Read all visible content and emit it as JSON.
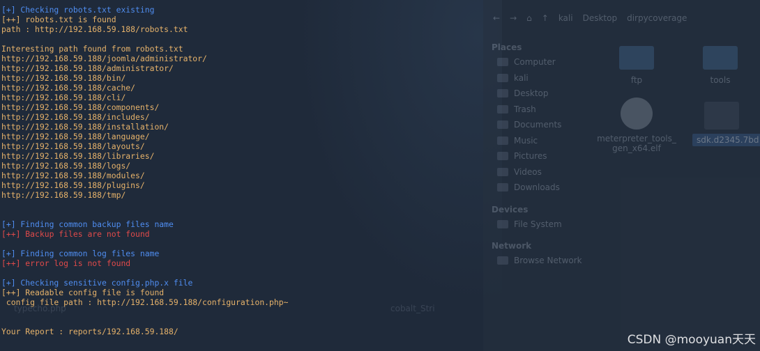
{
  "file_manager": {
    "toolbar": [
      "←",
      "→",
      "⌂",
      "↑",
      "kali",
      "Desktop",
      "dirpycoverage"
    ],
    "places_title": "Places",
    "places": [
      "Computer",
      "kali",
      "Desktop",
      "Trash",
      "Documents",
      "Music",
      "Pictures",
      "Videos",
      "Downloads"
    ],
    "devices_title": "Devices",
    "devices": [
      "File System"
    ],
    "network_title": "Network",
    "network": [
      "Browse Network"
    ],
    "files": [
      {
        "name": "ftp",
        "kind": "folder"
      },
      {
        "name": "tools",
        "kind": "folder"
      },
      {
        "name": "meterpreter_tools_gen_x64.elf",
        "kind": "gear"
      },
      {
        "name": "sdk.d2345.7bd",
        "kind": "selected"
      }
    ]
  },
  "desktop_icons": [
    "typecho.php",
    "cobalt_Stri"
  ],
  "terminal": {
    "lines": [
      {
        "text": "[+] Checking robots.txt existing",
        "color": "blue"
      },
      {
        "text": "[++] robots.txt is found",
        "color": "orange"
      },
      {
        "text": "path : http://192.168.59.188/robots.txt",
        "color": "orange"
      },
      {
        "text": "",
        "color": "orange"
      },
      {
        "text": "Interesting path found from robots.txt",
        "color": "orange"
      },
      {
        "text": "http://192.168.59.188/joomla/administrator/",
        "color": "orange"
      },
      {
        "text": "http://192.168.59.188/administrator/",
        "color": "orange"
      },
      {
        "text": "http://192.168.59.188/bin/",
        "color": "orange"
      },
      {
        "text": "http://192.168.59.188/cache/",
        "color": "orange"
      },
      {
        "text": "http://192.168.59.188/cli/",
        "color": "orange"
      },
      {
        "text": "http://192.168.59.188/components/",
        "color": "orange"
      },
      {
        "text": "http://192.168.59.188/includes/",
        "color": "orange"
      },
      {
        "text": "http://192.168.59.188/installation/",
        "color": "orange"
      },
      {
        "text": "http://192.168.59.188/language/",
        "color": "orange"
      },
      {
        "text": "http://192.168.59.188/layouts/",
        "color": "orange"
      },
      {
        "text": "http://192.168.59.188/libraries/",
        "color": "orange"
      },
      {
        "text": "http://192.168.59.188/logs/",
        "color": "orange"
      },
      {
        "text": "http://192.168.59.188/modules/",
        "color": "orange"
      },
      {
        "text": "http://192.168.59.188/plugins/",
        "color": "orange"
      },
      {
        "text": "http://192.168.59.188/tmp/",
        "color": "orange"
      },
      {
        "text": "",
        "color": "orange"
      },
      {
        "text": "",
        "color": "orange"
      },
      {
        "text": "[+] Finding common backup files name",
        "color": "blue"
      },
      {
        "text": "[++] Backup files are not found",
        "color": "red"
      },
      {
        "text": "",
        "color": "orange"
      },
      {
        "text": "[+] Finding common log files name",
        "color": "blue"
      },
      {
        "text": "[++] error log is not found",
        "color": "red"
      },
      {
        "text": "",
        "color": "orange"
      },
      {
        "text": "[+] Checking sensitive config.php.x file",
        "color": "blue"
      },
      {
        "text": "[++] Readable config file is found",
        "color": "orange"
      },
      {
        "text": " config file path : http://192.168.59.188/configuration.php~",
        "color": "orange"
      },
      {
        "text": "",
        "color": "orange"
      },
      {
        "text": "",
        "color": "orange"
      },
      {
        "text": "Your Report : reports/192.168.59.188/",
        "color": "orange"
      }
    ]
  },
  "watermark": "CSDN @mooyuan天天",
  "colors": {
    "blue": "#4f8df0",
    "orange": "#e6b26a",
    "red": "#e04a4a",
    "background": "#1f2a3a"
  }
}
